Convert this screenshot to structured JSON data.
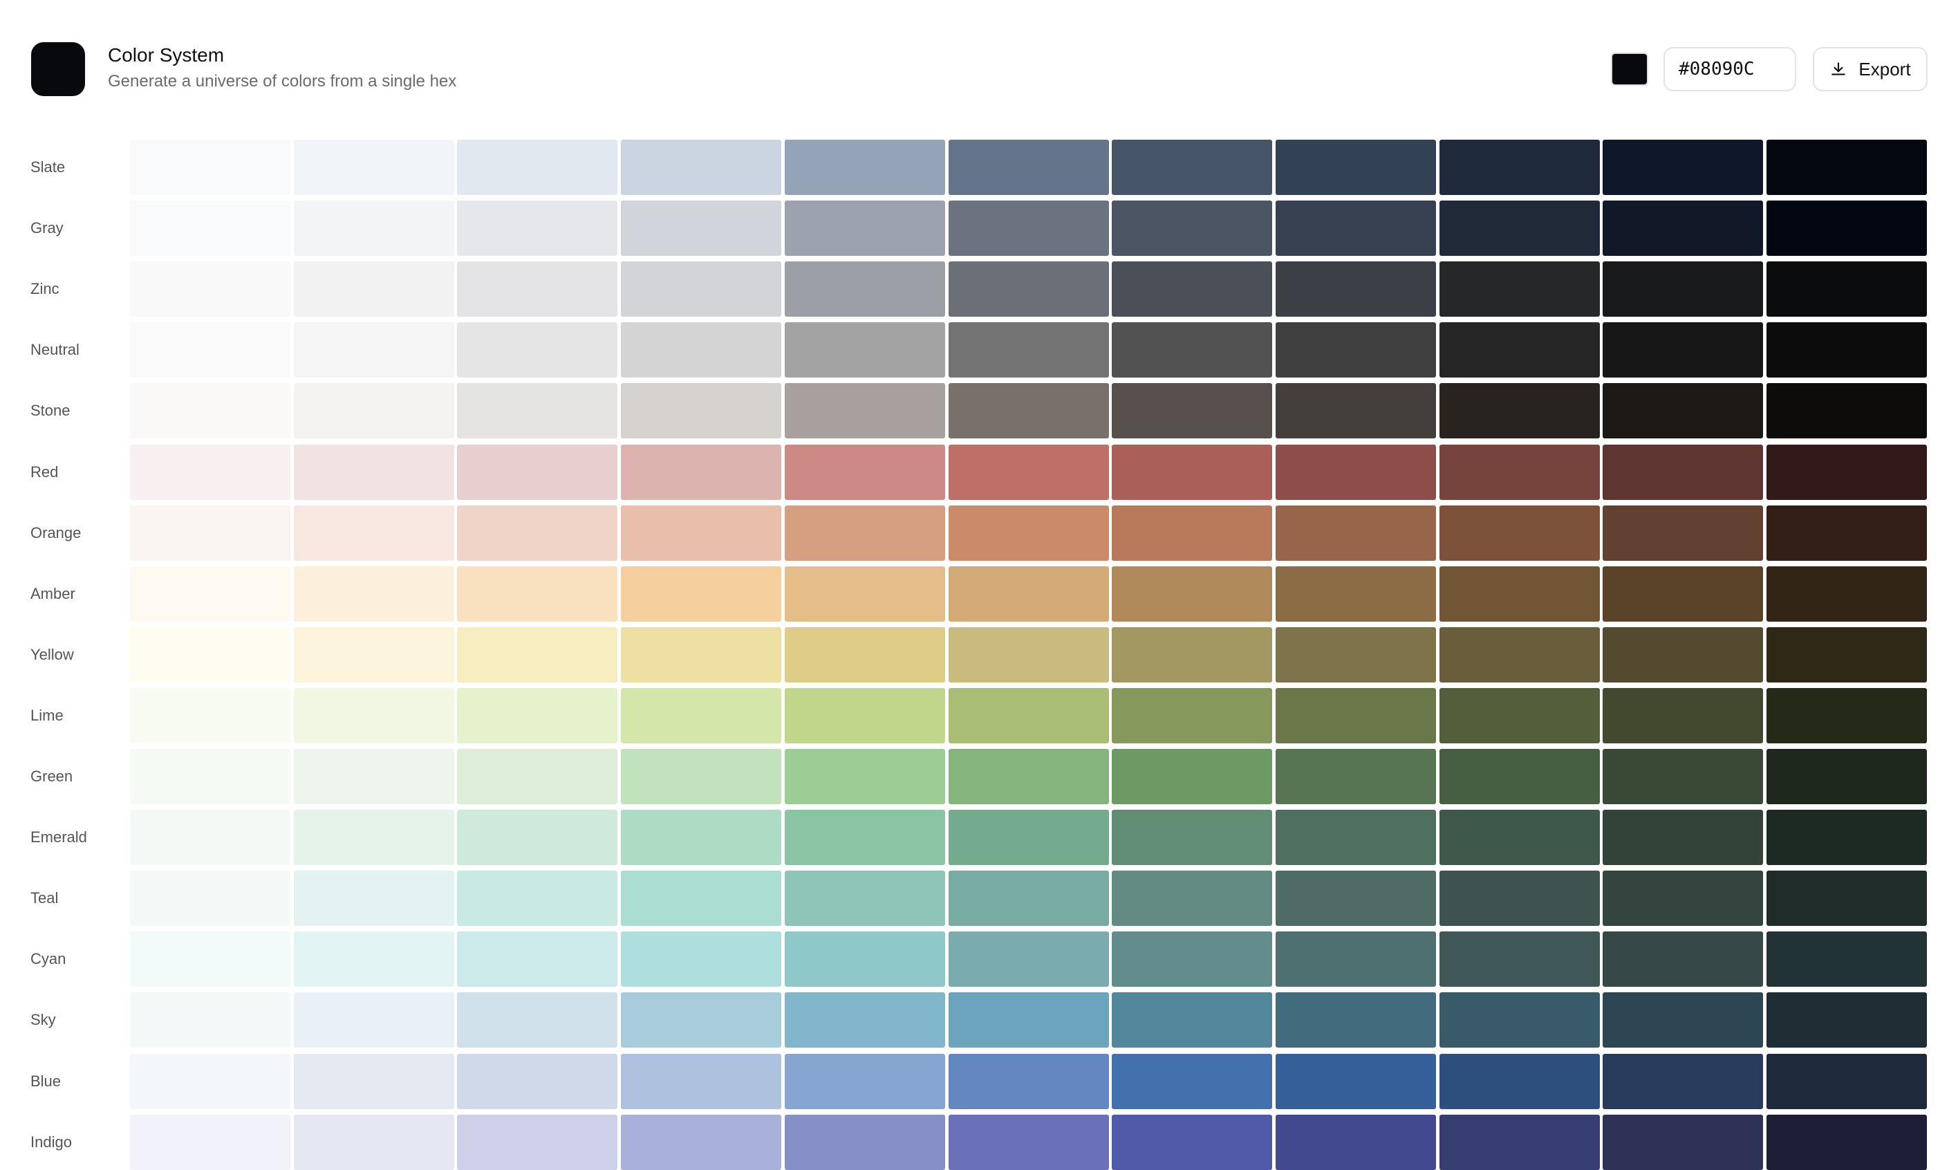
{
  "header": {
    "title": "Color System",
    "subtitle": "Generate a universe of colors from a single hex",
    "hex_value": "#08090C",
    "export_label": "Export",
    "base_color": "#08090C"
  },
  "palette": [
    {
      "name": "Slate",
      "colors": [
        "#F8FAFC",
        "#F1F5F9",
        "#E2E8F0",
        "#CBD5E1",
        "#94A3B8",
        "#64748B",
        "#475569",
        "#334155",
        "#1E293B",
        "#0F172A",
        "#040810"
      ]
    },
    {
      "name": "Gray",
      "colors": [
        "#F9FAFB",
        "#F3F4F6",
        "#E5E7EB",
        "#D1D5DB",
        "#9CA3AF",
        "#6B7280",
        "#4B5563",
        "#374151",
        "#1F2937",
        "#111827",
        "#030712"
      ]
    },
    {
      "name": "Zinc",
      "colors": [
        "#F9F9F9",
        "#F2F2F3",
        "#E4E4E6",
        "#D3D4D7",
        "#9CA0A6",
        "#6B7078",
        "#4B5058",
        "#3B3F46",
        "#262729",
        "#18191B",
        "#0B0C0D"
      ]
    },
    {
      "name": "Neutral",
      "colors": [
        "#FAFAFA",
        "#F5F5F5",
        "#E5E5E5",
        "#D4D4D4",
        "#A3A3A3",
        "#737373",
        "#525252",
        "#404040",
        "#262626",
        "#171717",
        "#0C0C0C"
      ]
    },
    {
      "name": "Stone",
      "colors": [
        "#FAF9F8",
        "#F4F3F2",
        "#E6E4E2",
        "#D6D2CF",
        "#A8A09D",
        "#7A706B",
        "#57504C",
        "#443E3C",
        "#28231F",
        "#1B1816",
        "#0E0C0A"
      ]
    },
    {
      "name": "Red",
      "colors": [
        "#F8F0F0",
        "#F2E3E3",
        "#E8CFCF",
        "#DDB3AF",
        "#CD8A84",
        "#BE6F68",
        "#AA5F59",
        "#8D4E4A",
        "#77433D",
        "#5F3531",
        "#321A18"
      ]
    },
    {
      "name": "Orange",
      "colors": [
        "#FBF5F2",
        "#F8E7E1",
        "#F1D4C8",
        "#E9BEAB",
        "#D69F81",
        "#CB8B6B",
        "#B87A5B",
        "#97654A",
        "#7D523B",
        "#624130",
        "#341F16"
      ]
    },
    {
      "name": "Amber",
      "colors": [
        "#FFFAF1",
        "#FCF0DD",
        "#F9E1C0",
        "#F6CF9F",
        "#E4BD88",
        "#D4AB76",
        "#B08A5B",
        "#8C6C45",
        "#715535",
        "#5A4329",
        "#332515"
      ]
    },
    {
      "name": "Yellow",
      "colors": [
        "#FFFCF2",
        "#FCF5DC",
        "#F8EDC1",
        "#EEDFA2",
        "#DFCC86",
        "#C9BB7D",
        "#A39762",
        "#7F7449",
        "#695D3B",
        "#544A2F",
        "#2E2917"
      ]
    },
    {
      "name": "Lime",
      "colors": [
        "#F8FBF1",
        "#F1F7E3",
        "#E6F2CB",
        "#D5E6AA",
        "#C0D78B",
        "#A9BE74",
        "#86985B",
        "#6A7748",
        "#535E3A",
        "#43492F",
        "#242918"
      ]
    },
    {
      "name": "Green",
      "colors": [
        "#F5FAF4",
        "#EEF5EC",
        "#DDEDD7",
        "#C2E1BD",
        "#9ECC95",
        "#85B57C",
        "#6D9964",
        "#577552",
        "#465E42",
        "#3A4935",
        "#1F281C"
      ]
    },
    {
      "name": "Emerald",
      "colors": [
        "#F3F9F5",
        "#E5F3EA",
        "#CFEADB",
        "#ADDBC3",
        "#8BC3A5",
        "#74AB8E",
        "#618D75",
        "#4F6F5F",
        "#3E584A",
        "#32433A",
        "#1D2A24"
      ]
    },
    {
      "name": "Teal",
      "colors": [
        "#F4F9F8",
        "#E4F3F1",
        "#C8EAE2",
        "#ABDDD3",
        "#8FC4B9",
        "#78ABA1",
        "#638A83",
        "#4F6B66",
        "#3E534F",
        "#34443F",
        "#1F2C29"
      ]
    },
    {
      "name": "Cyan",
      "colors": [
        "#F2FBFA",
        "#E3F4F4",
        "#CCEAE9",
        "#AEDEDE",
        "#8FC8C8",
        "#7AACAF",
        "#638C8D",
        "#4E7071",
        "#405758",
        "#364848",
        "#213334"
      ]
    },
    {
      "name": "Sky",
      "colors": [
        "#F3F8F9",
        "#E9F0F6",
        "#D0E1EB",
        "#A9CCDC",
        "#81B6CD",
        "#6CA4BD",
        "#52879C",
        "#426B7E",
        "#385A69",
        "#2E4654",
        "#1F2E35"
      ]
    },
    {
      "name": "Blue",
      "colors": [
        "#F3F6FA",
        "#E4E9F2",
        "#CFD9E9",
        "#AEC2E0",
        "#86A5D0",
        "#6387C0",
        "#4271AD",
        "#345F99",
        "#2C4F7E",
        "#2A3C5E",
        "#1E293B"
      ]
    },
    {
      "name": "Indigo",
      "colors": [
        "#F1F2FA",
        "#E5E7F3",
        "#CDD0E8",
        "#A9B1DB",
        "#878FC9",
        "#6A71B8",
        "#5159A9",
        "#43498F",
        "#363D70",
        "#2E3256",
        "#1C1F35"
      ]
    }
  ]
}
